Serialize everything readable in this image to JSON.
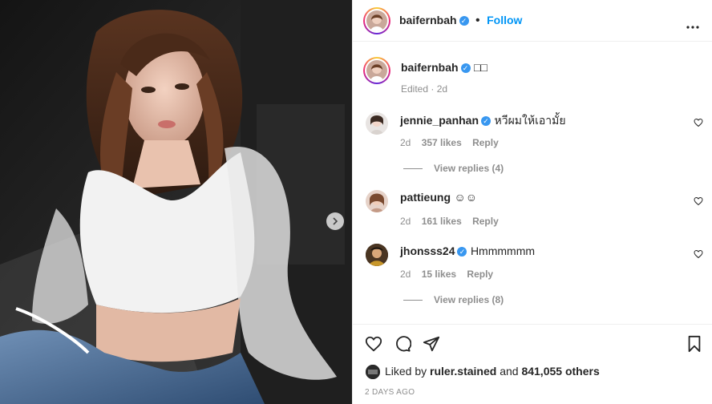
{
  "post": {
    "username": "baifernbah",
    "follow_label": "Follow",
    "dot": "•",
    "more_icon": "more-horizontal-icon"
  },
  "caption": {
    "username": "baifernbah",
    "text": "□□",
    "meta": "Edited · 2d"
  },
  "comments": [
    {
      "username": "jennie_panhan",
      "verified": true,
      "text": "หวีผมให้เอามั้ย",
      "age": "2d",
      "likes": "357 likes",
      "reply": "Reply",
      "view_replies": "View replies (4)"
    },
    {
      "username": "pattieung",
      "verified": false,
      "text": "☺☺",
      "age": "2d",
      "likes": "161 likes",
      "reply": "Reply",
      "view_replies": ""
    },
    {
      "username": "jhonsss24",
      "verified": true,
      "text": "Hmmmmmm",
      "age": "2d",
      "likes": "15 likes",
      "reply": "Reply",
      "view_replies": "View replies (8)"
    }
  ],
  "likes": {
    "prefix": "Liked by",
    "user": "ruler.stained",
    "middle": "and",
    "count": "841,055 others"
  },
  "timestamp": "2 DAYS AGO",
  "colors": {
    "accent": "#0095f6",
    "verified": "#3897f0",
    "muted": "#8e8e8e",
    "text": "#262626"
  }
}
